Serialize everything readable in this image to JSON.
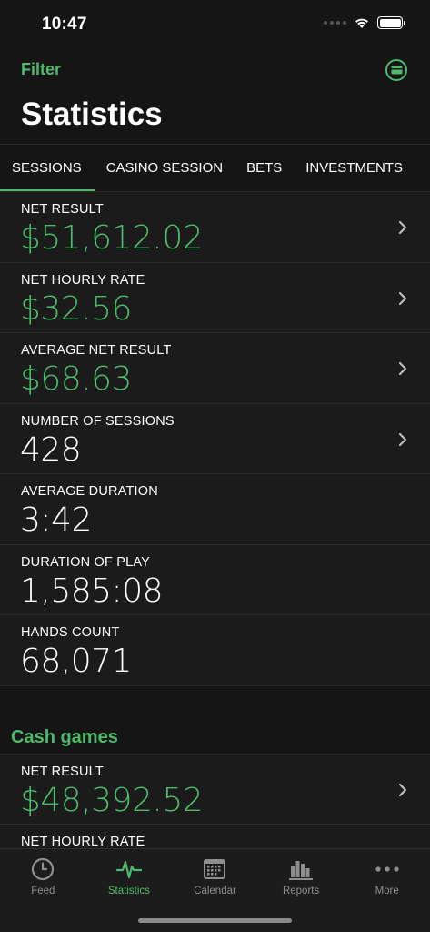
{
  "status_bar": {
    "time": "10:47"
  },
  "nav": {
    "filter_label": "Filter",
    "title": "Statistics"
  },
  "tabs": [
    {
      "label": "SESSIONS",
      "active": true
    },
    {
      "label": "CASINO SESSION",
      "active": false
    },
    {
      "label": "BETS",
      "active": false
    },
    {
      "label": "INVESTMENTS",
      "active": false
    }
  ],
  "rows": [
    {
      "label": "NET RESULT",
      "value": "$51,612.02"
    },
    {
      "label": "NET HOURLY RATE",
      "value": "$32.56"
    },
    {
      "label": "AVERAGE NET RESULT",
      "value": "$68.63"
    },
    {
      "label": "NUMBER OF SESSIONS",
      "value": "428"
    },
    {
      "label": "AVERAGE DURATION",
      "value": "3:42"
    },
    {
      "label": "DURATION OF PLAY",
      "value": "1,585:08"
    },
    {
      "label": "HANDS COUNT",
      "value": "68,071"
    }
  ],
  "cash_games": {
    "title": "Cash games",
    "rows": [
      {
        "label": "NET RESULT",
        "value": "$48,392.52"
      },
      {
        "label": "NET HOURLY RATE",
        "value": ""
      }
    ]
  },
  "tab_bar": [
    {
      "label": "Feed",
      "icon": "clock-icon"
    },
    {
      "label": "Statistics",
      "icon": "pulse-icon"
    },
    {
      "label": "Calendar",
      "icon": "calendar-icon"
    },
    {
      "label": "Reports",
      "icon": "bar-chart-icon"
    },
    {
      "label": "More",
      "icon": "more-icon"
    }
  ],
  "colors": {
    "accent": "#4cba6a",
    "background": "#151515",
    "row_background": "#1b1b1b"
  }
}
